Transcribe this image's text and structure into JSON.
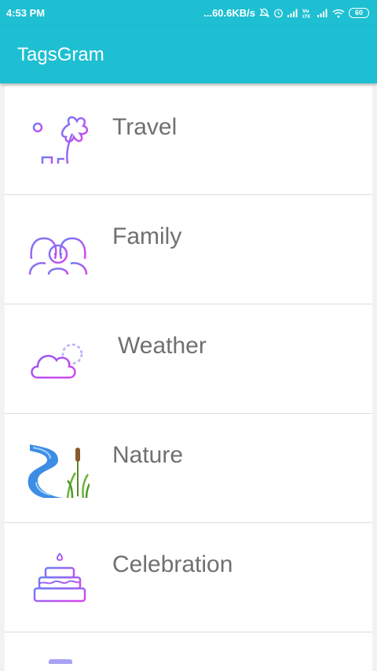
{
  "status_bar": {
    "time": "4:53 PM",
    "network_speed": "...60.6KB/s",
    "battery": "60",
    "icons": [
      "mute-icon",
      "alarm-icon",
      "signal-icon",
      "volte-icon",
      "signal-icon",
      "wifi-icon",
      "battery-icon"
    ]
  },
  "app_bar": {
    "title": "TagsGram"
  },
  "categories": [
    {
      "label": "Travel",
      "icon": "palm-tree-icon"
    },
    {
      "label": "Family",
      "icon": "family-icon"
    },
    {
      "label": " Weather",
      "icon": "weather-icon"
    },
    {
      "label": "Nature",
      "icon": "nature-icon"
    },
    {
      "label": "Celebration",
      "icon": "cake-icon"
    }
  ],
  "colors": {
    "primary": "#1ebfd2",
    "icon_gradient_start": "#8a5cf6",
    "icon_gradient_end": "#d946ef",
    "label": "#707070"
  }
}
